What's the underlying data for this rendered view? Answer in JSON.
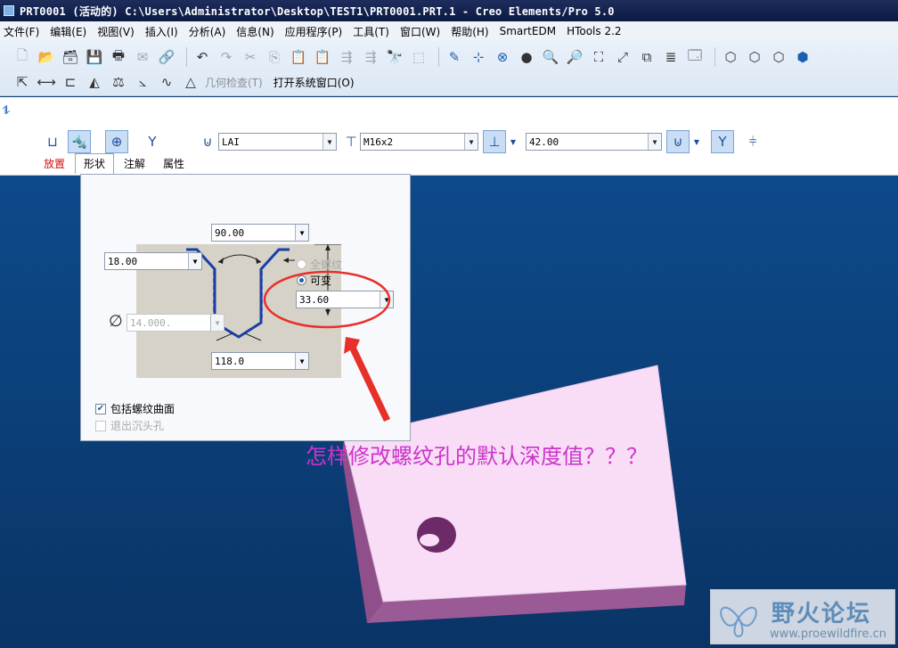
{
  "window": {
    "title": "PRT0001 (活动的) C:\\Users\\Administrator\\Desktop\\TEST1\\PRT0001.PRT.1 - Creo Elements/Pro 5.0"
  },
  "menubar": {
    "items": [
      "文件(F)",
      "编辑(E)",
      "视图(V)",
      "插入(I)",
      "分析(A)",
      "信息(N)",
      "应用程序(P)",
      "工具(T)",
      "窗口(W)",
      "帮助(H)",
      "SmartEDM",
      "HTools 2.2"
    ]
  },
  "toolbar": {
    "geometry_check": "几何检查(T)",
    "open_system_window": "打开系统窗口(O)"
  },
  "dashboard": {
    "thread_standard": "LAI",
    "screw_size": "M16x2",
    "depth_value": "42.00",
    "tabs": [
      "放置",
      "形状",
      "注解",
      "属性"
    ]
  },
  "shape_panel": {
    "angle": "90.00",
    "countersink_dia": "18.00",
    "thread_option_full": "全螺纹",
    "thread_option_variable": "可变",
    "thread_depth": "33.60",
    "hole_dia": "14.000.",
    "drill_angle": "118.0",
    "include_thread_surface": "包括螺纹曲面",
    "exit_countersink": "退出沉头孔"
  },
  "annotation": {
    "question": "怎样修改螺纹孔的默认深度值？？？"
  },
  "watermark": {
    "cn": "野火论坛",
    "url": "www.proewildfire.cn"
  },
  "colors": {
    "viewport": "#0b3f78",
    "part": "#f5d2f2",
    "question": "#cc33cc",
    "callout": "#e8302a"
  }
}
